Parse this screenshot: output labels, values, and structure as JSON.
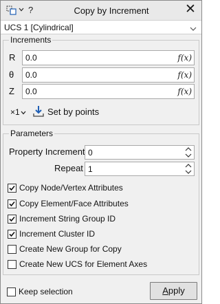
{
  "titlebar": {
    "title": "Copy by Increment",
    "help_glyph": "?",
    "close_glyph": "✕",
    "app_icon": "copy-shape-icon",
    "icons": [
      "copy-shape-icon",
      "chevron-down-icon",
      "help-icon",
      "close-icon"
    ]
  },
  "ucs": {
    "selected": "UCS 1 [Cylindrical]"
  },
  "increments": {
    "group_title": "Increments",
    "rows": [
      {
        "label": "R",
        "value": "0.0",
        "fx": "f(x)"
      },
      {
        "label": "θ",
        "value": "0.0",
        "fx": "f(x)"
      },
      {
        "label": "Z",
        "value": "0.0",
        "fx": "f(x)"
      }
    ],
    "multiplier": "×1",
    "set_by_points": "Set by points"
  },
  "parameters": {
    "group_title": "Parameters",
    "property_increment_label": "Property Increment",
    "property_increment_value": "0",
    "repeat_label": "Repeat",
    "repeat_value": "1",
    "checkboxes": [
      {
        "label": "Copy Node/Vertex Attributes",
        "checked": true
      },
      {
        "label": "Copy Element/Face Attributes",
        "checked": true
      },
      {
        "label": "Increment String Group ID",
        "checked": true
      },
      {
        "label": "Increment Cluster ID",
        "checked": true
      },
      {
        "label": "Create New Group for Copy",
        "checked": false
      },
      {
        "label": "Create New UCS for Element Axes",
        "checked": false
      }
    ]
  },
  "footer": {
    "keep_selection_label": "Keep selection",
    "keep_selection_checked": false,
    "apply_label": "Apply",
    "apply_mnemonic": "A",
    "apply_rest": "pply"
  },
  "colors": {
    "dialog_bg": "#f0f0f0",
    "titlebar_bg": "#e9e9e9",
    "field_border": "#a9a9a9",
    "accent_blue": "#1f5fb5"
  }
}
